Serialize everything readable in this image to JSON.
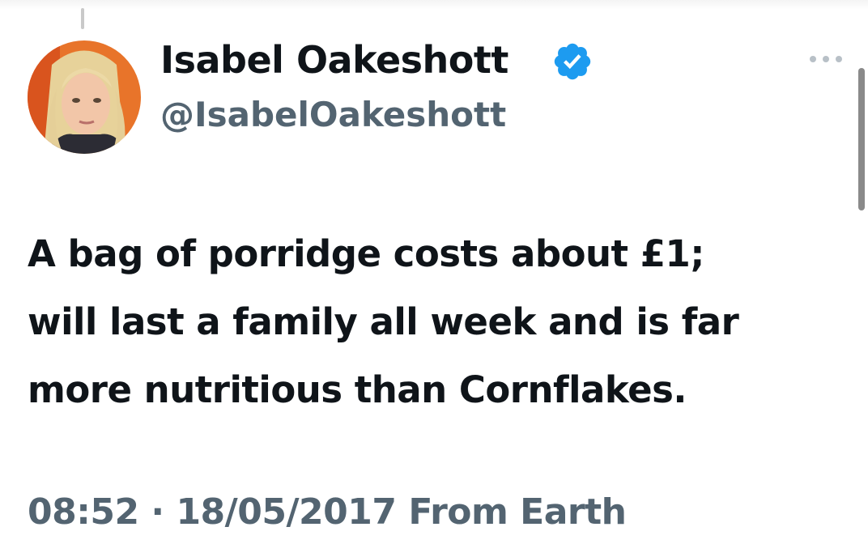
{
  "author": {
    "display_name": "Isabel Oakeshott",
    "handle": "@IsabelOakeshott",
    "avatar": "profile-photo",
    "verified_icon": "verified-badge-icon",
    "verified_color": "#1d9bf0"
  },
  "tweet": {
    "lines": [
      "A bag of porridge costs about £1;",
      "will last a family all week and is far",
      "more nutritious than Cornflakes."
    ]
  },
  "meta": {
    "time": "08:52",
    "separator": "·",
    "date": "18/05/2017",
    "source": "From Earth"
  },
  "menu": {
    "more_icon": "more-options-icon"
  },
  "colors": {
    "text": "#0f1419",
    "secondary": "#536471"
  }
}
